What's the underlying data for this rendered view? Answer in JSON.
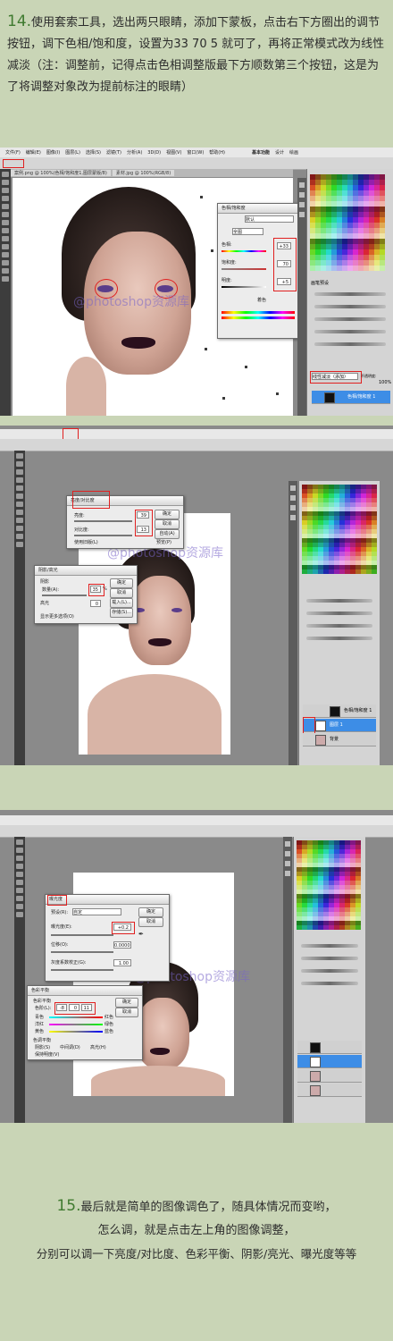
{
  "step14": {
    "number": "14.",
    "text": "使用套索工具，选出两只眼睛，添加下蒙板，点击右下方圈出的调节按钮，调下色相/饱和度，设置为33 70 5 就可了，再将正常模式改为线性减淡（注：调整前，记得点击色相调整版最下方顺数第三个按钮，这是为了将调整对象改为提前标注的眼睛）"
  },
  "watermark": "@photoshop资源库",
  "shot1": {
    "menu": [
      "文件(F)",
      "编辑(E)",
      "图像(I)",
      "图层(L)",
      "选择(S)",
      "滤镜(T)",
      "分析(A)",
      "3D(D)",
      "视图(V)",
      "窗口(W)",
      "帮助(H)",
      "基本功能",
      "设计",
      "绘画"
    ],
    "tab": "案例.png @ 100%(色相/饱和度1,图层蒙版/8)",
    "tab2": "素材.jpg @ 100%(RGB/8)",
    "dialog_title": "色相/饱和度",
    "preset": "默认",
    "channel": "全图",
    "hue_label": "色相:",
    "sat_label": "饱和度:",
    "light_label": "明度:",
    "hue": "+33",
    "saturation": "70",
    "lightness": "+5",
    "colorize": "着色",
    "blend_mode": "线性减淡（添加）",
    "opacity_label": "不透明度:",
    "opacity": "100%",
    "brush_panel": "画笔预设",
    "layer_name": "色相/饱和度 1"
  },
  "shot2": {
    "dialog_title": "亮度/对比度",
    "brightness_label": "亮度:",
    "contrast_label": "对比度:",
    "brightness": "39",
    "contrast": "13",
    "ok": "确定",
    "cancel": "取消",
    "auto": "自动(A)",
    "legacy": "使用旧版(L)",
    "preview": "预览(P)",
    "dialog2_title": "阴影/高光",
    "shadows": "阴影",
    "amount_label": "数量(A):",
    "amount": "35",
    "percent": "%",
    "highlights": "高光",
    "highlight_amount": "0",
    "more_options": "显示更多选项(O)",
    "load": "载入(L)...",
    "save": "存储(S)...",
    "layers": [
      "色相/饱和度 1",
      "图层 1",
      "背景"
    ]
  },
  "shot3": {
    "dialog_title": "曝光度",
    "preset_label": "预设(R):",
    "preset": "自定",
    "exposure_label": "曝光度(E):",
    "exposure": "+0.2",
    "offset_label": "位移(O):",
    "offset": "0.0000",
    "gamma_label": "灰度系数校正(G):",
    "gamma": "1.00",
    "ok": "确定",
    "cancel": "取消",
    "dialog2_title": "色彩平衡",
    "balance_label": "色彩平衡",
    "levels_label": "色阶(L):",
    "levels": [
      "-8",
      "0",
      "11"
    ],
    "cyan": "青色",
    "red": "红色",
    "magenta": "洋红",
    "green": "绿色",
    "yellow": "黄色",
    "blue": "蓝色",
    "tone_label": "色调平衡",
    "shadows": "阴影(S)",
    "midtones": "中间调(D)",
    "highlights": "高光(H)",
    "preserve": "保持明度(V)"
  },
  "step15": {
    "number": "15.",
    "line1": "最后就是简单的图像调色了，随具体情况而变哟，",
    "line2": "怎么调，就是点击左上角的图像调整，",
    "line3": "分别可以调一下亮度/对比度、色彩平衡、阴影/亮光、曝光度等等"
  }
}
